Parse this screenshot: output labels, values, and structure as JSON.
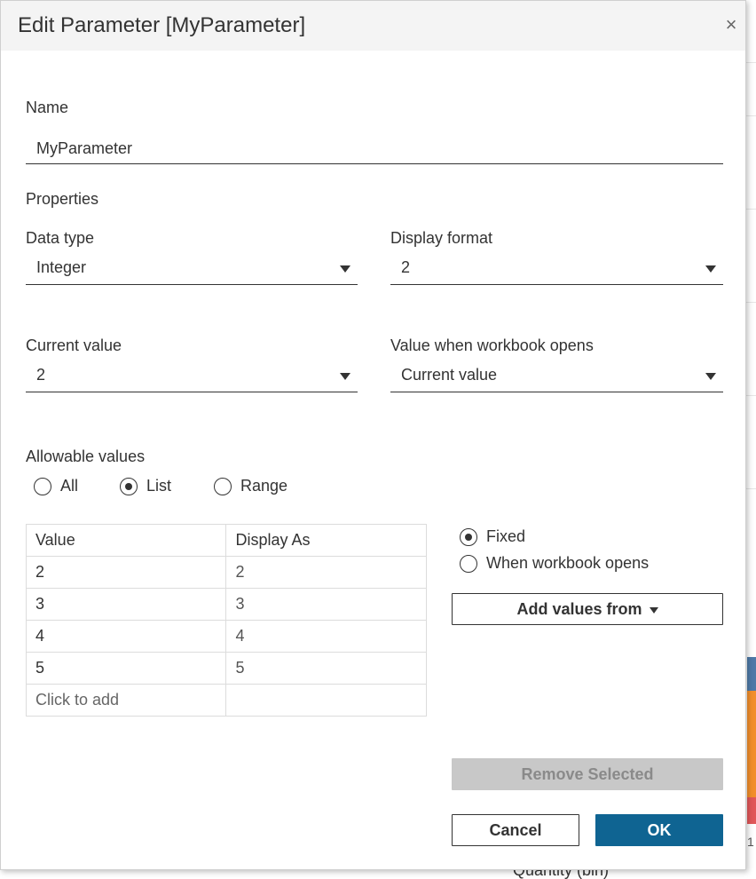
{
  "dialog": {
    "title": "Edit Parameter [MyParameter]",
    "close_icon": "×"
  },
  "name": {
    "label": "Name",
    "value": "MyParameter"
  },
  "properties": {
    "heading": "Properties",
    "data_type": {
      "label": "Data type",
      "value": "Integer"
    },
    "display_format": {
      "label": "Display format",
      "value": "2"
    },
    "current_value": {
      "label": "Current value",
      "value": "2"
    },
    "value_when_opens": {
      "label": "Value when workbook opens",
      "value": "Current value"
    }
  },
  "allowable": {
    "label": "Allowable values",
    "options": [
      "All",
      "List",
      "Range"
    ],
    "selected": "List"
  },
  "list_table": {
    "headers": [
      "Value",
      "Display As"
    ],
    "rows": [
      [
        "2",
        "2"
      ],
      [
        "3",
        "3"
      ],
      [
        "4",
        "4"
      ],
      [
        "5",
        "5"
      ]
    ],
    "add_row_text": "Click to add"
  },
  "source": {
    "options": [
      "Fixed",
      "When workbook opens"
    ],
    "selected": "Fixed",
    "add_values_button": "Add values from"
  },
  "buttons": {
    "remove_selected": "Remove Selected",
    "cancel": "Cancel",
    "ok": "OK"
  },
  "background": {
    "axis_label": "Quantity (bin)",
    "tick_label": "1",
    "bar_colors": [
      "#4e79a7",
      "#f28e2b",
      "#e15759"
    ]
  }
}
